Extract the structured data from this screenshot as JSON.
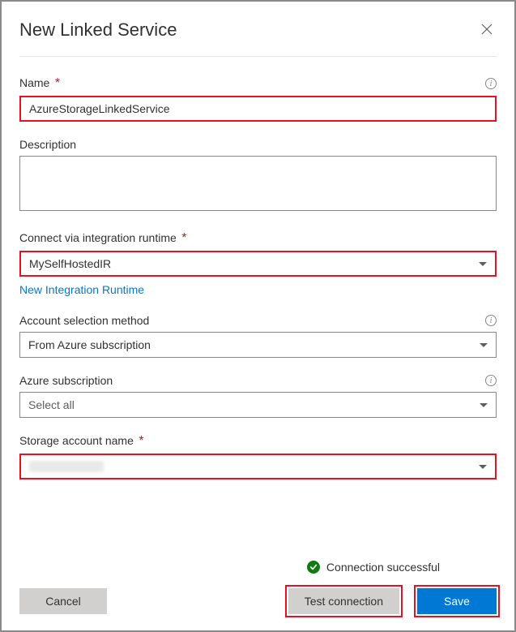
{
  "header": {
    "title": "New Linked Service"
  },
  "fields": {
    "name": {
      "label": "Name",
      "value": "AzureStorageLinkedService"
    },
    "description": {
      "label": "Description",
      "value": ""
    },
    "runtime": {
      "label": "Connect via integration runtime",
      "value": "MySelfHostedIR",
      "link": "New Integration Runtime"
    },
    "accountMethod": {
      "label": "Account selection method",
      "value": "From Azure subscription"
    },
    "subscription": {
      "label": "Azure subscription",
      "value": "Select all"
    },
    "storageAccount": {
      "label": "Storage account name"
    }
  },
  "status": {
    "text": "Connection successful"
  },
  "buttons": {
    "cancel": "Cancel",
    "test": "Test connection",
    "save": "Save"
  }
}
